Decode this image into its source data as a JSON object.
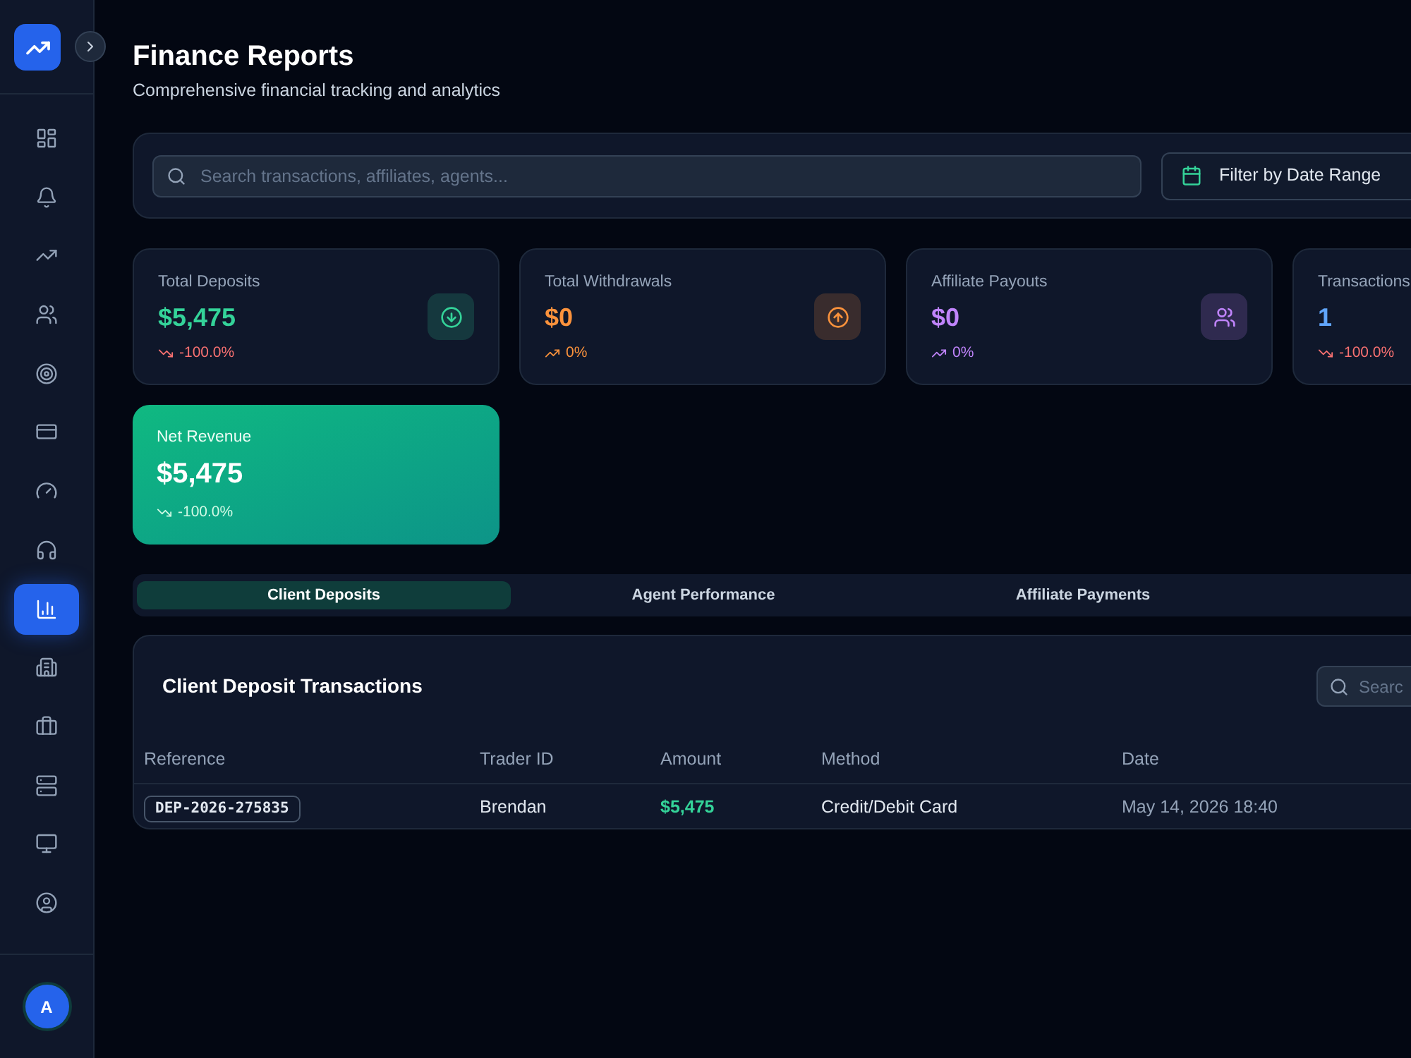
{
  "sidebar": {
    "items": [
      {
        "selected": false
      },
      {
        "selected": false
      },
      {
        "selected": false
      },
      {
        "selected": false
      },
      {
        "selected": false
      },
      {
        "selected": false
      },
      {
        "selected": false
      },
      {
        "selected": false
      },
      {
        "selected": true
      },
      {
        "selected": false
      },
      {
        "selected": false
      },
      {
        "selected": false
      },
      {
        "selected": false
      },
      {
        "selected": false
      }
    ]
  },
  "avatar": {
    "initial": "A"
  },
  "header": {
    "title": "Finance Reports",
    "subtitle": "Comprehensive financial tracking and analytics"
  },
  "search": {
    "placeholder": "Search transactions, affiliates, agents..."
  },
  "filter_button": {
    "label": "Filter by Date Range"
  },
  "stats": [
    {
      "label": "Total Deposits",
      "value": "$5,475",
      "change": "-100.0%",
      "trend_down": true,
      "color": "#34d399"
    },
    {
      "label": "Total Withdrawals",
      "value": "$0",
      "change": "0%",
      "trend_down": false,
      "color": "#fb923c"
    },
    {
      "label": "Affiliate Payouts",
      "value": "$0",
      "change": "0%",
      "trend_down": false,
      "color": "#c084fc"
    },
    {
      "label": "Transactions",
      "value": "1",
      "change": "-100.0%",
      "trend_down": true,
      "color": "#60a5fa"
    }
  ],
  "net_revenue": {
    "label": "Net Revenue",
    "value": "$5,475",
    "change": "-100.0%",
    "trend_down": true
  },
  "tabs": [
    {
      "label": "Client Deposits",
      "selected": true
    },
    {
      "label": "Agent Performance",
      "selected": false
    },
    {
      "label": "Affiliate Payments",
      "selected": false
    }
  ],
  "table": {
    "title": "Client Deposit Transactions",
    "search": {
      "placeholder": "Searc"
    },
    "columns": [
      {
        "label": "Reference",
        "kind": "badge"
      },
      {
        "label": "Trader ID",
        "kind": "text"
      },
      {
        "label": "Amount",
        "kind": "amount"
      },
      {
        "label": "Method",
        "kind": "text"
      },
      {
        "label": "Date",
        "kind": "muted"
      }
    ],
    "rows": [
      [
        "DEP-2026-275835",
        "Brendan",
        "$5,475",
        "Credit/Debit Card",
        "May 14, 2026 18:40"
      ]
    ]
  }
}
